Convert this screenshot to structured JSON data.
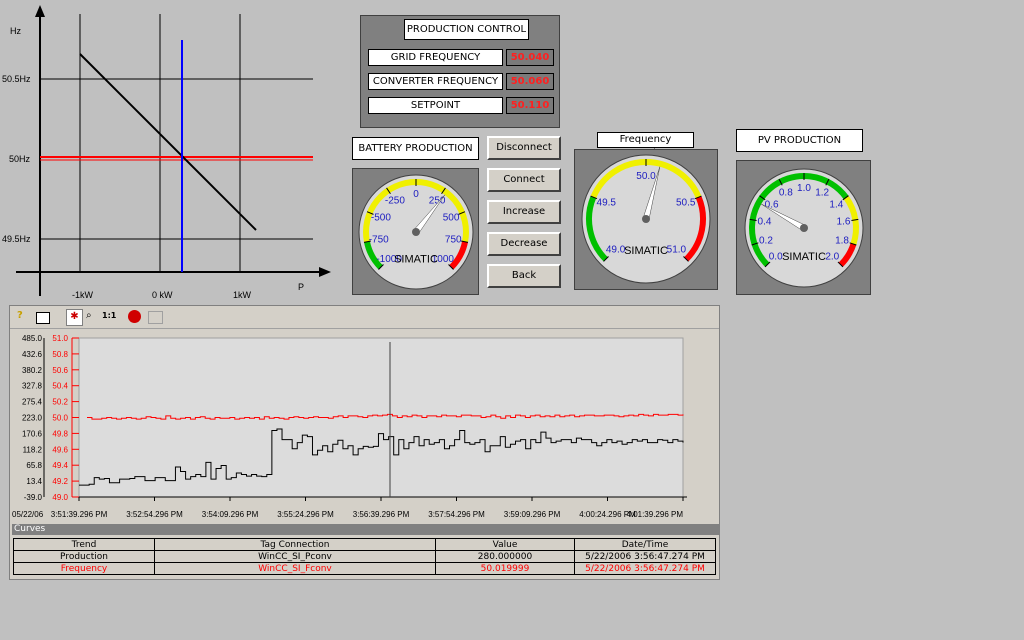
{
  "pq_chart": {
    "y_unit": "Hz",
    "x_unit": "P",
    "y_ticks": [
      "50.5Hz",
      "50Hz",
      "49.5Hz"
    ],
    "x_ticks": [
      "-1kW",
      "0 kW",
      "1kW"
    ]
  },
  "production_control": {
    "title": "PRODUCTION CONTROL",
    "rows": [
      {
        "label": "GRID FREQUENCY",
        "value": "50.040"
      },
      {
        "label": "CONVERTER FREQUENCY",
        "value": "50.060"
      },
      {
        "label": "SETPOINT",
        "value": "50.110"
      }
    ]
  },
  "buttons": {
    "disconnect": "Disconnect",
    "connect": "Connect",
    "increase": "Increase",
    "decrease": "Decrease",
    "back": "Back"
  },
  "gauges": {
    "battery": {
      "title": "BATTERY PRODUCTION",
      "brand": "SIMATIC",
      "labels": [
        "-1000",
        "-750",
        "-500",
        "-250",
        "0",
        "250",
        "500",
        "750",
        "1000"
      ],
      "value": 280
    },
    "frequency": {
      "title": "Frequency SetPoint",
      "brand": "SIMATIC",
      "labels": [
        "49.0",
        "49.5",
        "50.0",
        "50.5",
        "51.0"
      ],
      "value": 50.11
    },
    "pv": {
      "title": "PV PRODUCTION",
      "brand": "SIMATIC",
      "labels": [
        "0.0",
        "0.2",
        "0.4",
        "0.6",
        "0.8",
        "1.0",
        "1.2",
        "1.4",
        "1.6",
        "1.8",
        "2.0"
      ],
      "value": 0.55
    }
  },
  "trend": {
    "left_axis": [
      "485.0",
      "432.6",
      "380.2",
      "327.8",
      "275.4",
      "223.0",
      "170.6",
      "118.2",
      "65.8",
      "13.4",
      "-39.0"
    ],
    "right_axis": [
      "51.0",
      "50.8",
      "50.6",
      "50.4",
      "50.2",
      "50.0",
      "49.8",
      "49.6",
      "49.4",
      "49.2",
      "49.0"
    ],
    "date_label": "05/22/06",
    "time_ticks": [
      "3:51:39.296 PM",
      "3:52:54.296 PM",
      "3:54:09.296 PM",
      "3:55:24.296 PM",
      "3:56:39.296 PM",
      "3:57:54.296 PM",
      "3:59:09.296 PM",
      "4:00:24.296 PM",
      "4:01:39.296 PM"
    ],
    "curves_header": "Curves",
    "table_headers": [
      "Trend",
      "Tag Connection",
      "Value",
      "Date/Time"
    ],
    "rows": [
      {
        "trend": "Production",
        "tag": "WinCC_SI_Pconv",
        "value": "280.000000",
        "datetime": "5/22/2006 3:56:47.274 PM"
      },
      {
        "trend": "Frequency",
        "tag": "WinCC_SI_Fconv",
        "value": "50.019999",
        "datetime": "5/22/2006 3:56:47.274 PM"
      }
    ],
    "toolbar_ratio": "1:1",
    "production_series": [
      0,
      0,
      3,
      25,
      20,
      22,
      8,
      8,
      20,
      20,
      22,
      28,
      28,
      15,
      15,
      25,
      25,
      15,
      15,
      60,
      45,
      20,
      28,
      35,
      28,
      75,
      20,
      55,
      65,
      20,
      25,
      40,
      35,
      30,
      35,
      30,
      28,
      35,
      180,
      185,
      150,
      150,
      120,
      140,
      165,
      160,
      100,
      115,
      130,
      110,
      135,
      148,
      120,
      130,
      100,
      120,
      128,
      125,
      128,
      170,
      150,
      160,
      100,
      150,
      120,
      140,
      160,
      130,
      150,
      135,
      140,
      150,
      120,
      130,
      150,
      180,
      140,
      135,
      140,
      150,
      110,
      130,
      130,
      160,
      125,
      135,
      145,
      150,
      120,
      150,
      140,
      175,
      155,
      140,
      145,
      150,
      150,
      140,
      155,
      150,
      150,
      140,
      130,
      140,
      150,
      140,
      145,
      135,
      140,
      150,
      145,
      150,
      140,
      140,
      150,
      148,
      140,
      150,
      145,
      140
    ],
    "frequency_series": [
      50.0,
      49.98,
      49.98,
      49.99,
      50.0,
      49.99,
      49.98,
      49.99,
      50.0,
      49.99,
      49.98,
      49.99,
      50.01,
      50.0,
      49.99,
      49.98,
      50.02,
      49.99,
      49.98,
      49.99,
      50.0,
      49.98,
      50.0,
      50.01,
      49.99,
      49.98,
      50.0,
      49.99,
      49.99,
      50.0,
      49.98,
      49.99,
      50.0,
      49.99,
      50.0,
      49.98,
      50.01,
      49.99,
      50.0,
      49.99,
      49.98,
      50.0,
      50.01,
      50.0,
      49.99,
      50.0,
      50.01,
      50.0,
      50.0,
      49.99,
      50.01,
      50.02,
      50.0,
      50.02,
      50.02,
      50.01,
      50.0,
      50.02,
      50.03,
      50.02,
      50.03,
      50.04,
      50.02,
      50.0,
      50.02,
      50.01,
      50.03,
      50.02,
      50.0,
      50.02,
      50.02,
      50.01,
      50.03,
      50.02,
      50.02,
      50.01,
      50.03,
      50.03,
      50.02,
      50.02,
      50.0,
      50.01,
      50.03,
      50.01,
      49.99,
      50.02,
      50.0,
      50.03,
      50.02,
      50.0,
      50.02,
      50.03,
      50.01,
      50.02,
      50.01,
      50.03,
      50.01,
      50.02,
      50.03,
      50.01,
      50.02,
      50.03,
      50.03,
      50.02,
      50.02,
      50.03,
      50.03,
      50.02,
      50.01,
      50.02,
      50.03,
      50.02,
      50.04,
      50.03,
      50.02,
      50.04,
      50.03,
      50.03,
      50.04,
      50.04,
      50.03,
      50.04
    ]
  }
}
